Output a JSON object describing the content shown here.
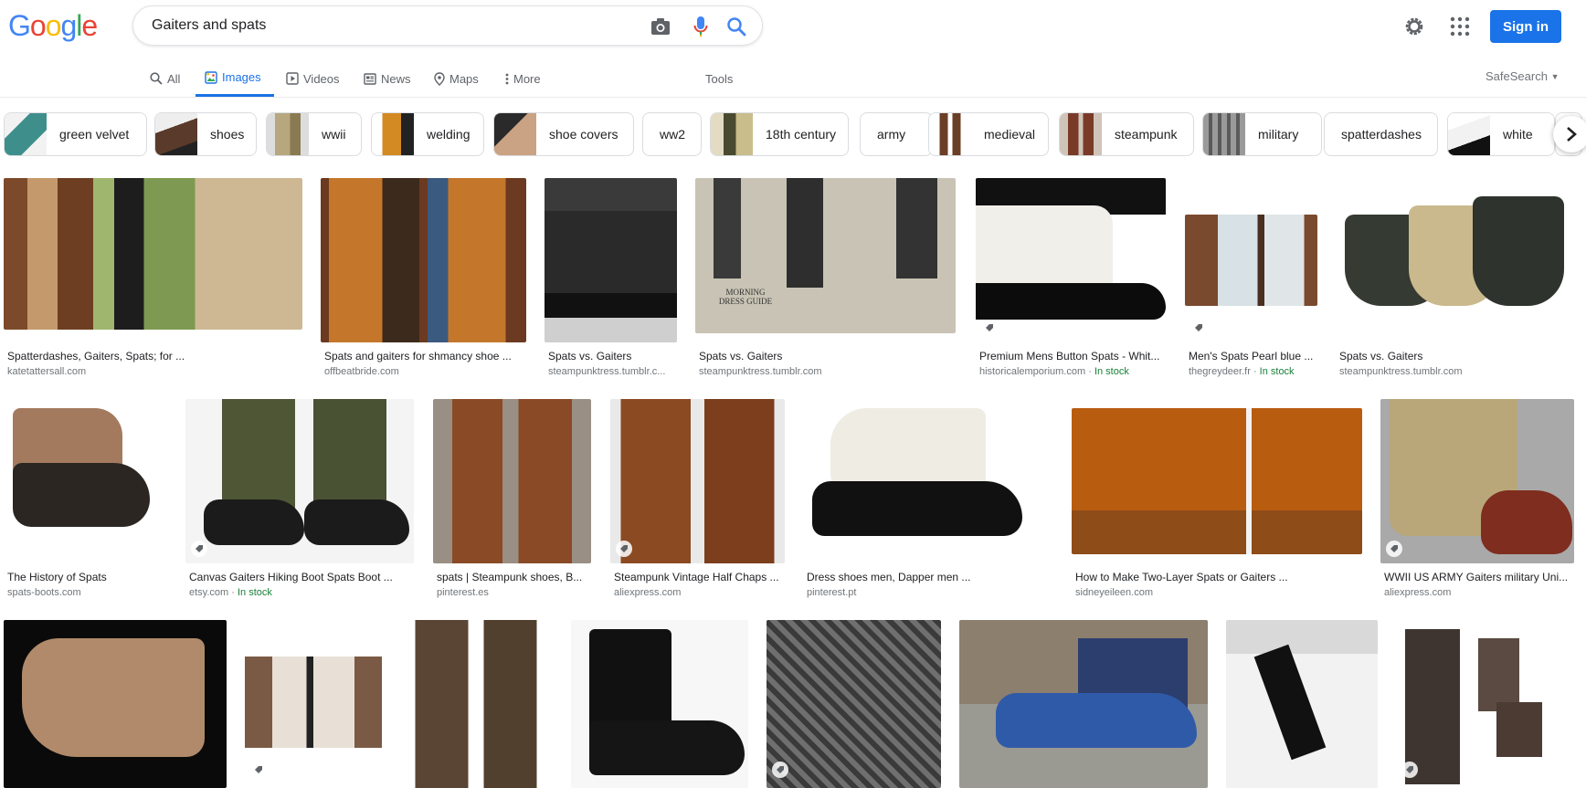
{
  "header": {
    "logo_letters": [
      {
        "ch": "G",
        "color": "#4285F4"
      },
      {
        "ch": "o",
        "color": "#EA4335"
      },
      {
        "ch": "o",
        "color": "#FBBC05"
      },
      {
        "ch": "g",
        "color": "#4285F4"
      },
      {
        "ch": "l",
        "color": "#34A853"
      },
      {
        "ch": "e",
        "color": "#EA4335"
      }
    ],
    "query": "Gaiters and spats",
    "sign_in": "Sign in"
  },
  "tabs": {
    "all": "All",
    "images": "Images",
    "videos": "Videos",
    "news": "News",
    "maps": "Maps",
    "more": "More",
    "tools": "Tools",
    "safesearch": "SafeSearch"
  },
  "chips": [
    {
      "label": "green velvet",
      "thumb": "#4a8c8a"
    },
    {
      "label": "shoes",
      "thumb": "#5a3a2a"
    },
    {
      "label": "wwii",
      "thumb": "#b6a77e"
    },
    {
      "label": "welding",
      "thumb": "#c47a1e"
    },
    {
      "label": "shoe covers",
      "thumb": "#c9a383"
    },
    {
      "label": "ww2",
      "thumb": ""
    },
    {
      "label": "18th century",
      "thumb": "#5d5a3a"
    },
    {
      "label": "army",
      "thumb": ""
    },
    {
      "label": "medieval",
      "thumb": "#6b3e26"
    },
    {
      "label": "steampunk",
      "thumb": "#7a3a28"
    },
    {
      "label": "military",
      "thumb": "#8a8a8a"
    },
    {
      "label": "spatterdashes",
      "thumb": ""
    },
    {
      "label": "white",
      "thumb": "#e8e8e8"
    }
  ],
  "results": [
    {
      "title": "Spatterdashes, Gaiters, Spats; for ...",
      "source": "katetattersall.com",
      "in_stock": ""
    },
    {
      "title": "Spats and gaiters for shmancy shoe ...",
      "source": "offbeatbride.com",
      "in_stock": ""
    },
    {
      "title": "Spats vs. Gaiters",
      "source": "steampunktress.tumblr.c...",
      "in_stock": ""
    },
    {
      "title": "Spats vs. Gaiters",
      "source": "steampunktress.tumblr.com",
      "in_stock": ""
    },
    {
      "title": "Premium Mens Button Spats - Whit...",
      "source": "historicalemporium.com",
      "in_stock": "In stock"
    },
    {
      "title": "Men's Spats Pearl blue ...",
      "source": "thegreydeer.fr",
      "in_stock": "In stock"
    },
    {
      "title": "Spats vs. Gaiters",
      "source": "steampunktress.tumblr.com",
      "in_stock": ""
    },
    {
      "title": "The History of Spats",
      "source": "spats-boots.com",
      "in_stock": ""
    },
    {
      "title": "Canvas Gaiters Hiking Boot Spats Boot ...",
      "source": "etsy.com",
      "in_stock": "In stock"
    },
    {
      "title": "spats | Steampunk shoes, B...",
      "source": "pinterest.es",
      "in_stock": ""
    },
    {
      "title": "Steampunk Vintage Half Chaps ...",
      "source": "aliexpress.com",
      "in_stock": ""
    },
    {
      "title": "Dress shoes men, Dapper men ...",
      "source": "pinterest.pt",
      "in_stock": ""
    },
    {
      "title": "How to Make Two-Layer Spats or Gaiters ...",
      "source": "sidneyeileen.com",
      "in_stock": ""
    },
    {
      "title": "WWII US ARMY Gaiters military Uni...",
      "source": "aliexpress.com",
      "in_stock": ""
    }
  ],
  "image_texts": {
    "morning_dress_guide": "MORNING DRESS GUIDE"
  },
  "colors": {
    "accent": "#1a73e8",
    "in_stock": "#188038",
    "muted": "#70757a"
  }
}
